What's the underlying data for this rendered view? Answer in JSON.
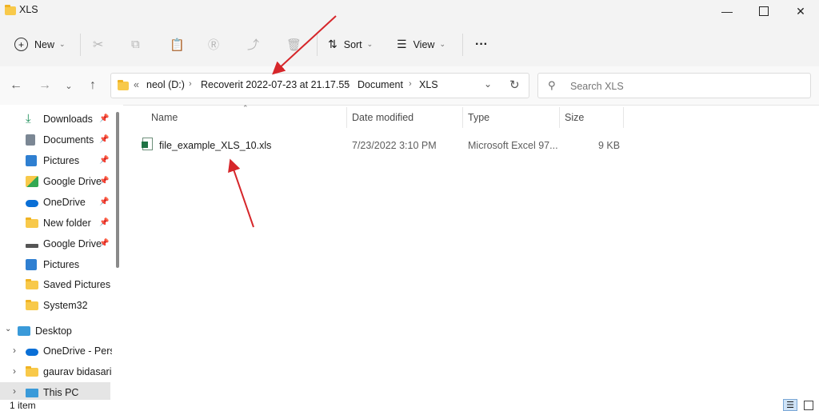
{
  "window": {
    "title": "XLS"
  },
  "toolbar": {
    "new_label": "New",
    "sort_label": "Sort",
    "view_label": "View",
    "more_label": "···"
  },
  "address": {
    "overflow": "«",
    "crumbs": [
      "neol (D:)",
      "Recoverit 2022-07-23 at 21.17.55",
      "Document",
      "XLS"
    ]
  },
  "search": {
    "placeholder": "Search XLS"
  },
  "sidebar": {
    "items": [
      {
        "label": "Downloads",
        "icon": "download-icon"
      },
      {
        "label": "Documents",
        "icon": "documents-icon"
      },
      {
        "label": "Pictures",
        "icon": "pictures-icon"
      },
      {
        "label": "Google Drive",
        "icon": "google-drive-icon"
      },
      {
        "label": "OneDrive",
        "icon": "onedrive-icon"
      },
      {
        "label": "New folder",
        "icon": "folder-icon"
      },
      {
        "label": "Google Drive",
        "icon": "drive-icon"
      },
      {
        "label": "Pictures",
        "icon": "pictures-icon"
      },
      {
        "label": "Saved Pictures",
        "icon": "folder-icon"
      },
      {
        "label": "System32",
        "icon": "folder-icon"
      },
      {
        "label": "Desktop",
        "icon": "desktop-icon"
      },
      {
        "label": "OneDrive - Perso",
        "icon": "onedrive-icon"
      },
      {
        "label": "gaurav bidasaria",
        "icon": "folder-icon"
      },
      {
        "label": "This PC",
        "icon": "this-pc-icon"
      }
    ]
  },
  "columns": {
    "name": "Name",
    "date": "Date modified",
    "type": "Type",
    "size": "Size"
  },
  "files": [
    {
      "name": "file_example_XLS_10.xls",
      "date": "7/23/2022 3:10 PM",
      "type": "Microsoft Excel 97...",
      "size": "9 KB"
    }
  ],
  "status": {
    "count": "1 item"
  },
  "colors": {
    "accent": "#0067c0",
    "folder": "#f8c94a",
    "arrow": "#d6262a",
    "excel": "#1f7244"
  }
}
